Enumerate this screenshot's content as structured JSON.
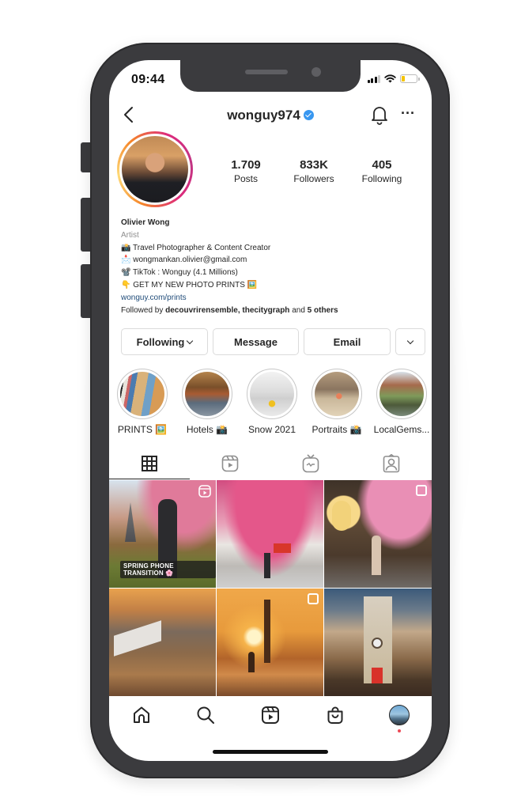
{
  "status_bar": {
    "time": "09:44",
    "battery_level": 0.2,
    "battery_color": "#f5c400"
  },
  "header": {
    "username": "wonguy974",
    "verified": true,
    "back_icon": "chevron-left-icon",
    "bell_icon": "bell-icon",
    "more_icon": "more-horizontal-icon",
    "more_label": "···"
  },
  "profile": {
    "stats": [
      {
        "value": "1.709",
        "label": "Posts"
      },
      {
        "value": "833K",
        "label": "Followers"
      },
      {
        "value": "405",
        "label": "Following"
      }
    ],
    "name": "Olivier Wong",
    "category": "Artist",
    "bio_lines": [
      "📸 Travel Photographer & Content Creator",
      "📩 wongmankan.olivier@gmail.com",
      "📽️ TikTok : Wonguy (4.1 Millions)",
      "👇 GET MY NEW PHOTO PRINTS 🖼️"
    ],
    "link": "wonguy.com/prints",
    "followed_by": {
      "prefix": "Followed by ",
      "names": "decouvrirensemble, thecitygraph",
      "suffix": " and ",
      "others": "5 others"
    }
  },
  "actions": {
    "following_label": "Following",
    "message_label": "Message",
    "email_label": "Email"
  },
  "highlights": [
    {
      "label": "PRINTS 🖼️"
    },
    {
      "label": "Hotels 📸"
    },
    {
      "label": "Snow 2021"
    },
    {
      "label": "Portraits 📸"
    },
    {
      "label": "LocalGems..."
    }
  ],
  "tabs": [
    {
      "name": "posts-grid",
      "icon": "grid-icon",
      "active": true
    },
    {
      "name": "reels",
      "icon": "reels-icon",
      "active": false
    },
    {
      "name": "igtv",
      "icon": "igtv-icon",
      "active": false
    },
    {
      "name": "tagged",
      "icon": "tagged-user-icon",
      "active": false
    }
  ],
  "grid_posts": [
    {
      "description": "Eiffel tower cherry blossom phone photo",
      "type": "reel",
      "caption": "SPRING PHONE TRANSITION 🌸"
    },
    {
      "description": "Cherry blossoms over Paris metro entrance",
      "type": "photo"
    },
    {
      "description": "Tokyo alley with lanterns",
      "type": "carousel"
    },
    {
      "description": "Seine river sunset with boats",
      "type": "photo"
    },
    {
      "description": "Pont Alexandre III lamp at sunset",
      "type": "carousel"
    },
    {
      "description": "Old town street at dusk with clock tower",
      "type": "photo"
    }
  ],
  "bottom_nav": [
    {
      "name": "home",
      "icon": "home-icon"
    },
    {
      "name": "search",
      "icon": "search-icon"
    },
    {
      "name": "reels",
      "icon": "reels-icon"
    },
    {
      "name": "shop",
      "icon": "shopping-bag-icon"
    },
    {
      "name": "profile",
      "icon": "profile-avatar",
      "notification_dot": true
    }
  ]
}
